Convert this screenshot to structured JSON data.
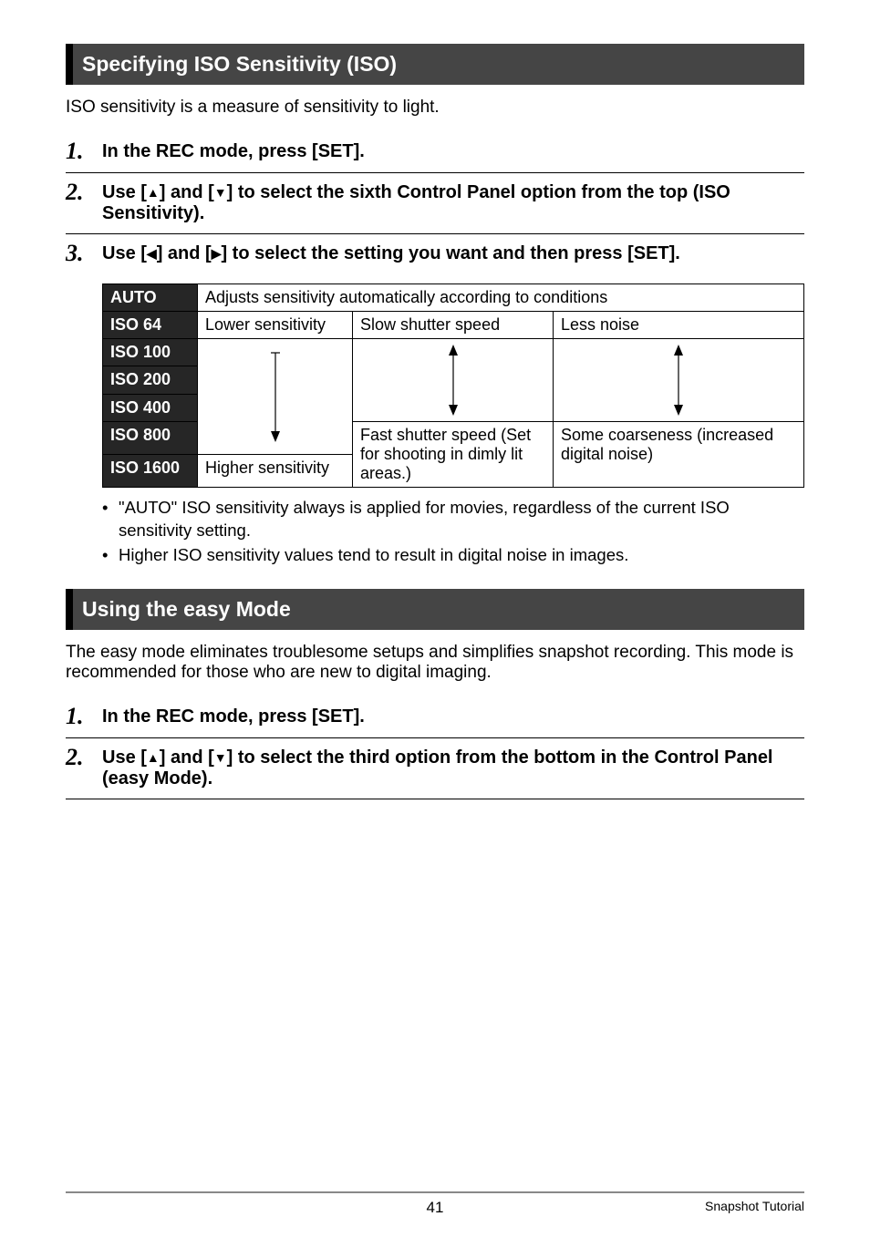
{
  "section1": {
    "title": "Specifying ISO Sensitivity (ISO)",
    "intro": "ISO sensitivity is a measure of sensitivity to light.",
    "steps": [
      {
        "num": "1.",
        "text": "In the REC mode, press [SET]."
      },
      {
        "num": "2.",
        "text_pre": "Use [",
        "text_mid": "] and [",
        "text_post": "] to select the sixth Control Panel option from the top (ISO Sensitivity)."
      },
      {
        "num": "3.",
        "text_pre": "Use [",
        "text_mid": "] and [",
        "text_post": "] to select the setting you want and then press [SET]."
      }
    ],
    "notes": [
      "\"AUTO\" ISO sensitivity always is applied for movies, regardless of the current ISO sensitivity setting.",
      "Higher ISO sensitivity values tend to result in digital noise in images."
    ]
  },
  "iso_table": {
    "rows_header": [
      "AUTO",
      "ISO 64",
      "ISO 100",
      "ISO 200",
      "ISO 400",
      "ISO 800",
      "ISO 1600"
    ],
    "auto_desc": "Adjusts sensitivity automatically according to conditions",
    "col1_top": "Lower sensitivity",
    "col1_bottom": "Higher sensitivity",
    "col2_top": "Slow shutter speed",
    "col2_bottom": "Fast shutter speed (Set for shooting in dimly lit areas.)",
    "col3_top": "Less noise",
    "col3_bottom": "Some coarseness (increased digital noise)"
  },
  "section2": {
    "title": "Using the easy Mode",
    "intro": "The easy mode eliminates troublesome setups and simplifies snapshot recording. This mode is recommended for those who are new to digital imaging.",
    "steps": [
      {
        "num": "1.",
        "text": "In the REC mode, press [SET]."
      },
      {
        "num": "2.",
        "text_pre": "Use [",
        "text_mid": "] and [",
        "text_post": "] to select the third option from the bottom in the Control Panel (easy Mode)."
      }
    ]
  },
  "footer": {
    "page": "41",
    "label": "Snapshot Tutorial"
  },
  "arrows": {
    "up": "▲",
    "down": "▼",
    "left": "◀",
    "right": "▶"
  }
}
